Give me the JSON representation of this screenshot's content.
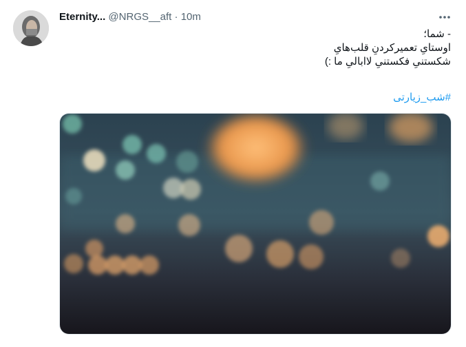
{
  "tweet": {
    "author": {
      "display_name": "Eternity...",
      "handle": "@NRGS__aft",
      "separator": "·",
      "time": "10m"
    },
    "text_lines": [
      "- شما؛",
      "اوستایِ تعمیرکردنِ قلب‌هایِ",
      "شکستنیِ فکستنیِ لاابالیِ ما :)"
    ],
    "hashtag": "#شب_زیارتی"
  },
  "icons": {
    "more": "more-dots-icon"
  }
}
